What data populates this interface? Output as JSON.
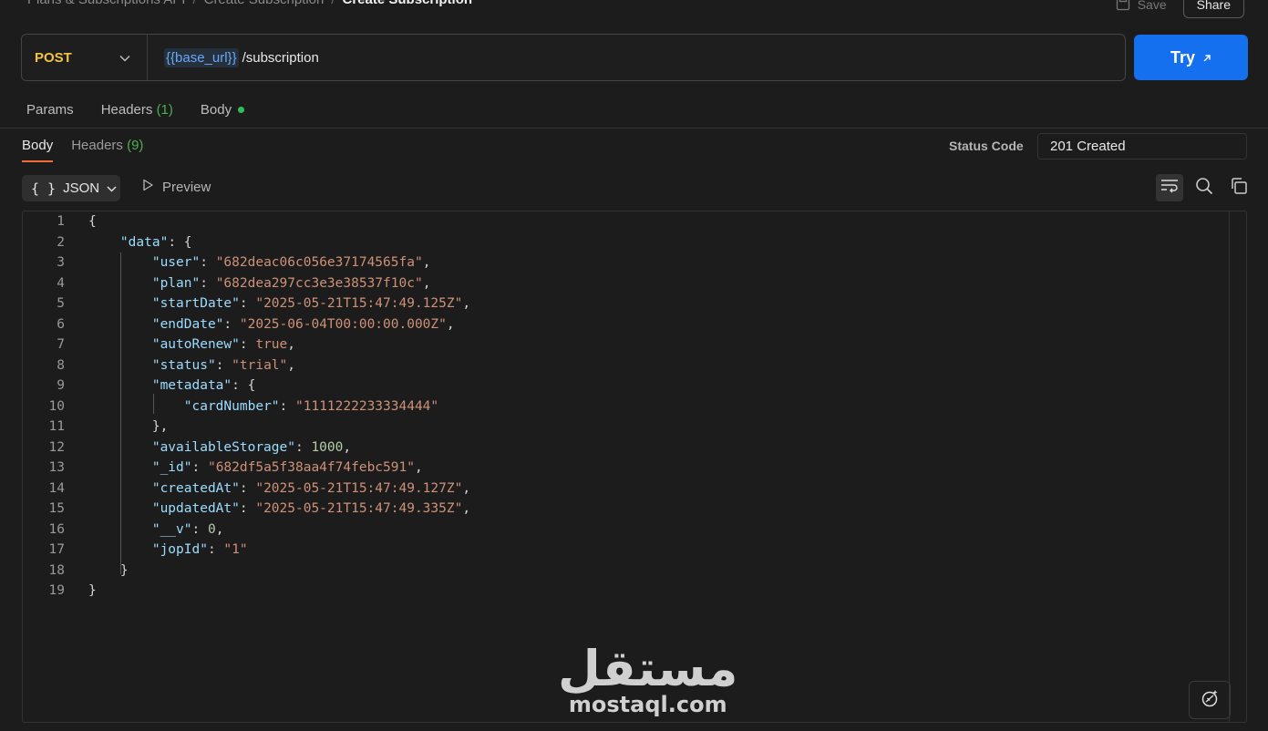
{
  "breadcrumb": {
    "items": [
      "Plans & Subscriptions API",
      "Create Subscription"
    ],
    "current": "Create Subscription"
  },
  "top_actions": {
    "save_label": "Save",
    "share_label": "Share"
  },
  "request": {
    "method": "POST",
    "url_variable": "{{base_url}}",
    "url_path": "/subscription",
    "try_label": "Try"
  },
  "request_tabs": [
    {
      "label": "Params"
    },
    {
      "label": "Headers",
      "count": "(1)"
    },
    {
      "label": "Body"
    }
  ],
  "response": {
    "tabs": [
      {
        "label": "Body",
        "active": true
      },
      {
        "label": "Headers",
        "count": "(9)"
      }
    ],
    "status_label": "Status Code",
    "status_value": "201 Created",
    "format": "JSON",
    "preview_label": "Preview"
  },
  "code_lines": [
    {
      "n": "1"
    },
    {
      "n": "2"
    },
    {
      "n": "3"
    },
    {
      "n": "4"
    },
    {
      "n": "5"
    },
    {
      "n": "6"
    },
    {
      "n": "7"
    },
    {
      "n": "8"
    },
    {
      "n": "9"
    },
    {
      "n": "10"
    },
    {
      "n": "11"
    },
    {
      "n": "12"
    },
    {
      "n": "13"
    },
    {
      "n": "14"
    },
    {
      "n": "15"
    },
    {
      "n": "16"
    },
    {
      "n": "17"
    },
    {
      "n": "18"
    },
    {
      "n": "19"
    }
  ],
  "json": {
    "data_key": "\"data\"",
    "fields": {
      "user": {
        "key": "\"user\"",
        "value": "\"682deac06c056e37174565fa\""
      },
      "plan": {
        "key": "\"plan\"",
        "value": "\"682dea297cc3e3e38537f10c\""
      },
      "startDate": {
        "key": "\"startDate\"",
        "value": "\"2025-05-21T15:47:49.125Z\""
      },
      "endDate": {
        "key": "\"endDate\"",
        "value": "\"2025-06-04T00:00:00.000Z\""
      },
      "autoRenew": {
        "key": "\"autoRenew\"",
        "value": "true"
      },
      "status": {
        "key": "\"status\"",
        "value": "\"trial\""
      },
      "metadata": {
        "key": "\"metadata\""
      },
      "cardNumber": {
        "key": "\"cardNumber\"",
        "value": "\"1111222233334444\""
      },
      "availableStorage": {
        "key": "\"availableStorage\"",
        "value": "1000"
      },
      "_id": {
        "key": "\"_id\"",
        "value": "\"682df5a5f38aa4f74febc591\""
      },
      "createdAt": {
        "key": "\"createdAt\"",
        "value": "\"2025-05-21T15:47:49.127Z\""
      },
      "updatedAt": {
        "key": "\"updatedAt\"",
        "value": "\"2025-05-21T15:47:49.335Z\""
      },
      "__v": {
        "key": "\"__v\"",
        "value": "0"
      },
      "jopId": {
        "key": "\"jopId\"",
        "value": "\"1\""
      }
    }
  },
  "watermark": {
    "arabic": "مستقل",
    "latin": "mostaql.com"
  },
  "colors": {
    "accent_blue": "#1570ef",
    "method_yellow": "#f5c343",
    "json_key": "#9cdcfe",
    "json_string": "#ce9178",
    "json_number": "#b5cea8",
    "tab_underline": "#f26b3a",
    "count_green": "#4caf50"
  },
  "icons": [
    "chevron-down-icon",
    "external-arrow-icon",
    "play-icon",
    "wrap-lines-icon",
    "search-icon",
    "copy-icon",
    "ai-assist-icon",
    "save-icon"
  ]
}
